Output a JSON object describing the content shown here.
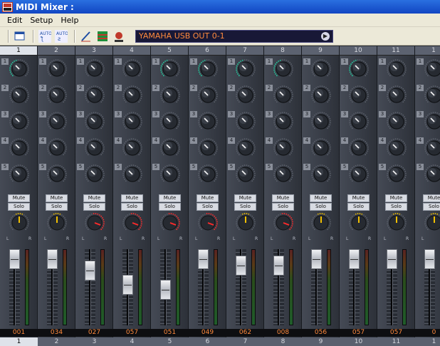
{
  "window": {
    "title": "MIDI Mixer :"
  },
  "menu": [
    "Edit",
    "Setup",
    "Help"
  ],
  "toolbar": {
    "buttons": [
      "window-icon",
      "auto-record-icon",
      "auto-play-icon",
      "pencil-icon",
      "grid-icon",
      "record-icon"
    ],
    "port": "YAMAHA USB OUT 0-1"
  },
  "colors": {
    "accent_value": "#ff8a3d",
    "knob_ring_active": "#1fd0a0",
    "pan_ring_active": "#ff2a2a",
    "pan_ring": "#f2c000"
  },
  "strip_labels": {
    "mute": "Mute",
    "solo": "Solo",
    "pan_left": "L",
    "pan_right": "R"
  },
  "channels": [
    {
      "num": "1",
      "knob_labels": [
        "1",
        "2",
        "3",
        "4",
        "5"
      ],
      "active_knobs": [
        1
      ],
      "value": "001",
      "fader": 0.0,
      "pan": "yellow",
      "footer": "1"
    },
    {
      "num": "2",
      "knob_labels": [
        "1",
        "2",
        "3",
        "4",
        "5"
      ],
      "active_knobs": [],
      "value": "034",
      "fader": 0.0,
      "pan": "yellow",
      "footer": "2"
    },
    {
      "num": "3",
      "knob_labels": [
        "1",
        "2",
        "3",
        "4",
        "5"
      ],
      "active_knobs": [],
      "value": "027",
      "fader": 0.2,
      "pan": "red",
      "footer": "3"
    },
    {
      "num": "4",
      "knob_labels": [
        "1",
        "2",
        "3",
        "4",
        "5"
      ],
      "active_knobs": [],
      "value": "057",
      "fader": 0.45,
      "pan": "red",
      "footer": "4"
    },
    {
      "num": "5",
      "knob_labels": [
        "1",
        "2",
        "3",
        "4",
        "5"
      ],
      "active_knobs": [
        1
      ],
      "value": "051",
      "fader": 0.55,
      "pan": "red",
      "footer": "5"
    },
    {
      "num": "6",
      "knob_labels": [
        "1",
        "2",
        "3",
        "4",
        "5"
      ],
      "active_knobs": [
        1
      ],
      "value": "049",
      "fader": 0.0,
      "pan": "red",
      "footer": "6"
    },
    {
      "num": "7",
      "knob_labels": [
        "1",
        "2",
        "3",
        "4",
        "5"
      ],
      "active_knobs": [
        1
      ],
      "value": "062",
      "fader": 0.12,
      "pan": "yellow",
      "footer": "7"
    },
    {
      "num": "8",
      "knob_labels": [
        "1",
        "2",
        "3",
        "4",
        "5"
      ],
      "active_knobs": [
        1
      ],
      "value": "008",
      "fader": 0.12,
      "pan": "red",
      "footer": "8"
    },
    {
      "num": "9",
      "knob_labels": [
        "1",
        "2",
        "3",
        "4",
        "5"
      ],
      "active_knobs": [],
      "value": "056",
      "fader": 0.0,
      "pan": "yellow",
      "footer": "9"
    },
    {
      "num": "10",
      "knob_labels": [
        "1",
        "2",
        "3",
        "4",
        "5"
      ],
      "active_knobs": [
        1
      ],
      "value": "057",
      "fader": 0.0,
      "pan": "yellow",
      "footer": "10"
    },
    {
      "num": "11",
      "knob_labels": [
        "1",
        "2",
        "3",
        "4",
        "5"
      ],
      "active_knobs": [],
      "value": "057",
      "fader": 0.0,
      "pan": "yellow",
      "footer": "11"
    },
    {
      "num": "1",
      "knob_labels": [
        "1",
        "2",
        "3",
        "4",
        "5"
      ],
      "active_knobs": [],
      "value": "0",
      "fader": 0.0,
      "pan": "yellow",
      "footer": "1"
    }
  ]
}
